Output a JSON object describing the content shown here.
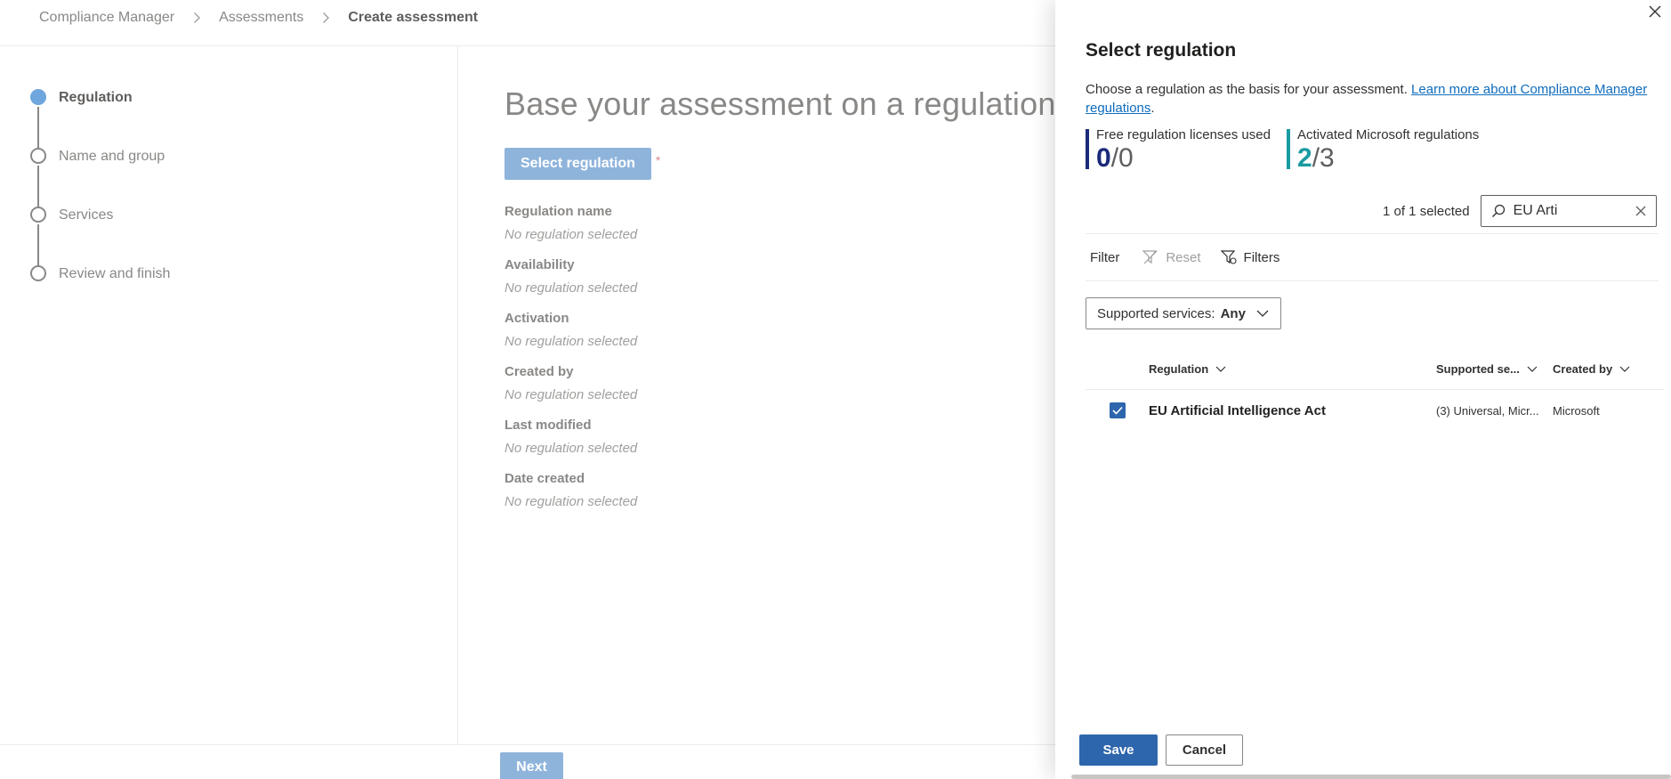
{
  "breadcrumb": [
    {
      "label": "Compliance Manager"
    },
    {
      "label": "Assessments"
    },
    {
      "label": "Create assessment"
    }
  ],
  "steps": [
    {
      "label": "Regulation",
      "active": true
    },
    {
      "label": "Name and group",
      "active": false
    },
    {
      "label": "Services",
      "active": false
    },
    {
      "label": "Review and finish",
      "active": false
    }
  ],
  "main": {
    "heading": "Base your assessment on a regulation",
    "select_button": "Select regulation",
    "required_mark": "*",
    "fields": [
      {
        "label": "Regulation name",
        "value": "No regulation selected"
      },
      {
        "label": "Availability",
        "value": "No regulation selected"
      },
      {
        "label": "Activation",
        "value": "No regulation selected"
      },
      {
        "label": "Created by",
        "value": "No regulation selected"
      },
      {
        "label": "Last modified",
        "value": "No regulation selected"
      },
      {
        "label": "Date created",
        "value": "No regulation selected"
      }
    ],
    "next_button": "Next"
  },
  "panel": {
    "title": "Select regulation",
    "description": "Choose a regulation as the basis for your assessment.",
    "description_link": "Learn more about Compliance Manager regulations",
    "description_end": ".",
    "stats": [
      {
        "label": "Free regulation licenses used",
        "num": "0",
        "den": "/0",
        "color": "#1b2a7a"
      },
      {
        "label": "Activated Microsoft regulations",
        "num": "2",
        "den": "/3",
        "color": "#1a9ba1"
      }
    ],
    "selected_count": "1 of 1 selected",
    "search": {
      "value": "EU Arti",
      "placeholder": "Search"
    },
    "filter": {
      "label": "Filter",
      "reset": "Reset",
      "filters": "Filters"
    },
    "services_dropdown": {
      "label": "Supported services:",
      "value": "Any"
    },
    "table": {
      "headers": {
        "regulation": "Regulation",
        "services": "Supported se...",
        "created_by": "Created by"
      },
      "rows": [
        {
          "checked": true,
          "regulation": "EU Artificial Intelligence Act",
          "services": "(3) Universal, Micr...",
          "created_by": "Microsoft"
        }
      ]
    },
    "save_button": "Save",
    "cancel_button": "Cancel"
  },
  "colors": {
    "primary": "#2e66ad",
    "primary_disabled": "#8fb4dc",
    "step_active": "#6fa6dd",
    "link": "#0f6cbd"
  }
}
